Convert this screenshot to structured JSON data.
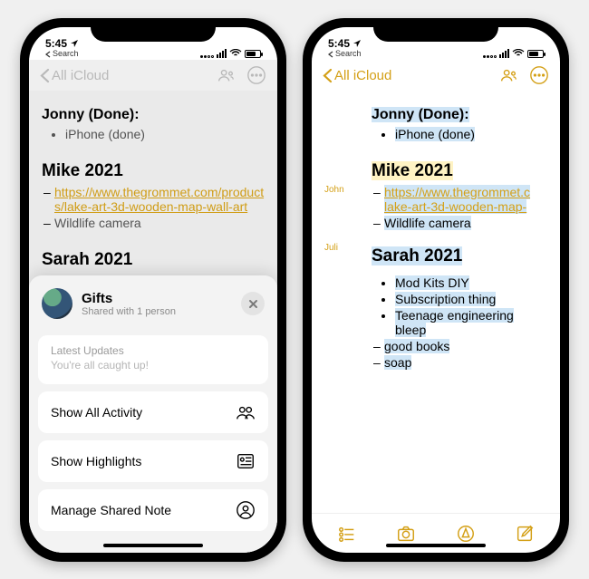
{
  "status": {
    "time": "5:45",
    "search_label": "Search"
  },
  "nav": {
    "back_label": "All iCloud"
  },
  "left_note": {
    "sec1_title": "Jonny (Done):",
    "sec1_items": [
      "iPhone (done)"
    ],
    "sec2_title": "Mike 2021",
    "sec2_link": "https://www.thegrommet.com/products/lake-art-3d-wooden-map-wall-art",
    "sec2_items": [
      "Wildlife camera"
    ],
    "sec3_title": "Sarah 2021",
    "sec3_items_partial": [
      "Mod Kits DIY"
    ]
  },
  "sheet": {
    "title": "Gifts",
    "subtitle": "Shared with 1 person",
    "updates_label": "Latest Updates",
    "updates_msg": "You're all caught up!",
    "opt1": "Show All Activity",
    "opt2": "Show Highlights",
    "opt3": "Manage Shared Note"
  },
  "right_note": {
    "author1": "John",
    "author2": "Juli",
    "sec1_title": "Jonny (Done):",
    "sec1_items": [
      "iPhone (done)"
    ],
    "sec2_title": "Mike 2021",
    "sec2_link": "https://www.thegrommet.c\nlake-art-3d-wooden-map-",
    "sec2_items": [
      "Wildlife camera"
    ],
    "sec3_title": "Sarah 2021",
    "sec3_bullets": [
      "Mod Kits DIY",
      "Subscription thing",
      "Teenage engineering bleep"
    ],
    "sec3_dashes": [
      "good books",
      "soap"
    ]
  }
}
